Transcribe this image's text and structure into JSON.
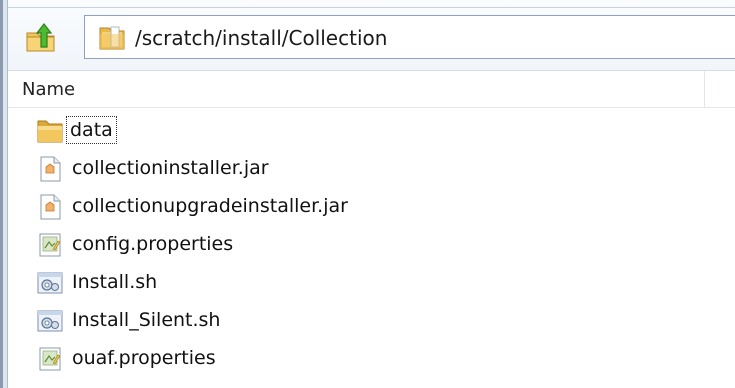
{
  "address": {
    "path": "/scratch/install/Collection",
    "folder_icon": "folder-icon"
  },
  "toolbar": {
    "up_icon": "up-folder-icon"
  },
  "columns": {
    "name_label": "Name"
  },
  "files": [
    {
      "name": "data",
      "icon": "folder-icon",
      "focused": true
    },
    {
      "name": "collectioninstaller.jar",
      "icon": "jar-file-icon",
      "focused": false
    },
    {
      "name": "collectionupgradeinstaller.jar",
      "icon": "jar-file-icon",
      "focused": false
    },
    {
      "name": "config.properties",
      "icon": "properties-file-icon",
      "focused": false
    },
    {
      "name": "Install.sh",
      "icon": "script-file-icon",
      "focused": false
    },
    {
      "name": "Install_Silent.sh",
      "icon": "script-file-icon",
      "focused": false
    },
    {
      "name": "ouaf.properties",
      "icon": "properties-file-icon",
      "focused": false
    }
  ],
  "colors": {
    "folder": "#e9b84a",
    "up_arrow": "#3fae2a",
    "border": "#8fa2bd"
  }
}
